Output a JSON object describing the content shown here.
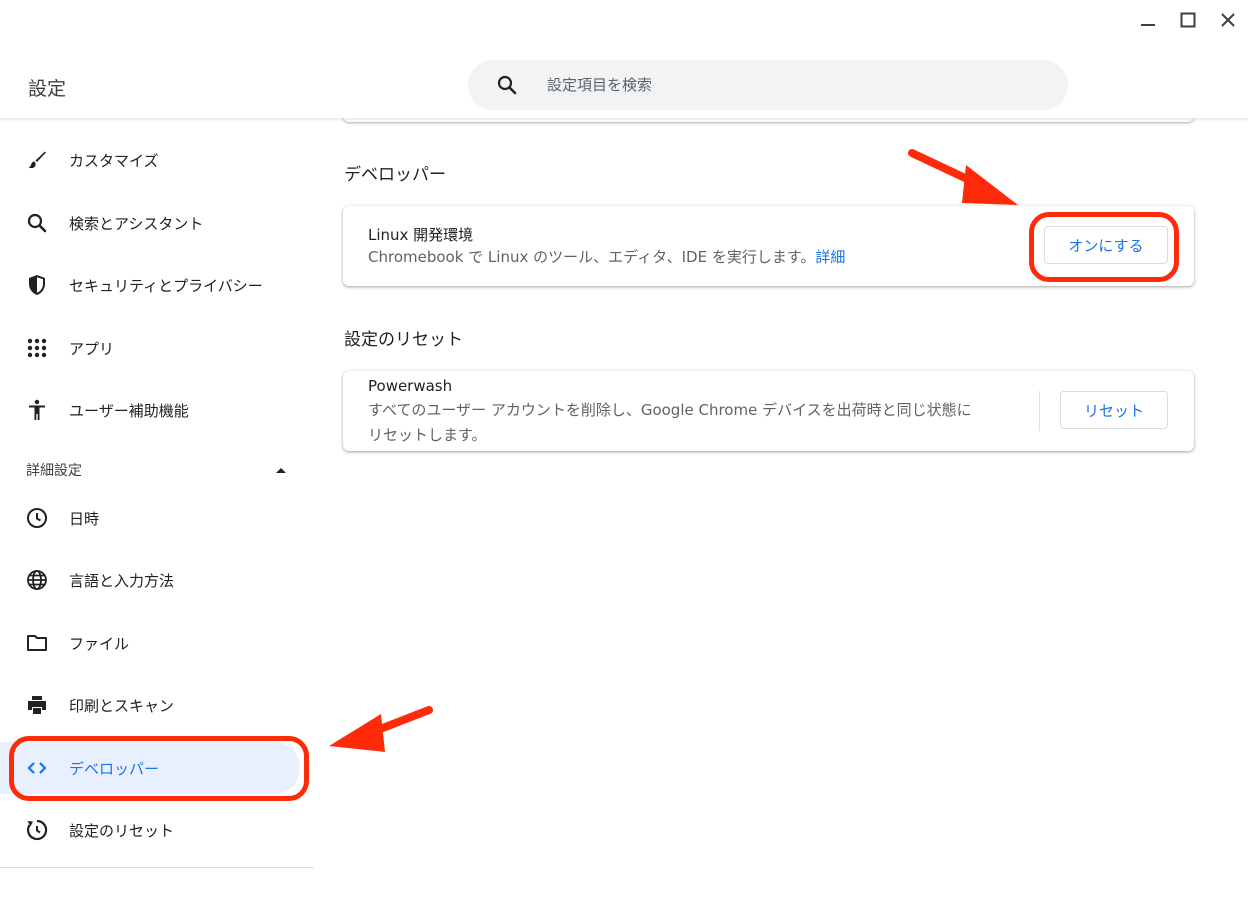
{
  "app": {
    "title": "設定"
  },
  "window_controls": {
    "minimize_icon": "minimize-icon",
    "maximize_icon": "maximize-icon",
    "close_icon": "close-icon"
  },
  "search": {
    "placeholder": "設定項目を検索",
    "icon": "search-icon"
  },
  "sidebar": {
    "items": [
      {
        "label": "カスタマイズ",
        "icon": "brush-icon"
      },
      {
        "label": "検索とアシスタント",
        "icon": "search-icon"
      },
      {
        "label": "セキュリティとプライバシー",
        "icon": "shield-icon"
      },
      {
        "label": "アプリ",
        "icon": "apps-grid-icon"
      },
      {
        "label": "ユーザー補助機能",
        "icon": "accessibility-icon"
      }
    ],
    "advanced": {
      "label": "詳細設定",
      "icon": "caret-up-icon"
    },
    "advanced_items": [
      {
        "label": "日時",
        "icon": "clock-icon"
      },
      {
        "label": "言語と入力方法",
        "icon": "globe-icon"
      },
      {
        "label": "ファイル",
        "icon": "folder-icon"
      },
      {
        "label": "印刷とスキャン",
        "icon": "printer-icon"
      },
      {
        "label": "デベロッパー",
        "icon": "code-icon",
        "active": true
      },
      {
        "label": "設定のリセット",
        "icon": "reset-icon"
      }
    ]
  },
  "main": {
    "developer": {
      "title": "デベロッパー",
      "linux": {
        "title": "Linux 開発環境",
        "description": "Chromebook で Linux のツール、エディタ、IDE を実行します。",
        "link": "詳細",
        "button": "オンにする"
      }
    },
    "reset": {
      "title": "設定のリセット",
      "powerwash": {
        "title": "Powerwash",
        "description_line1": "すべてのユーザー アカウントを削除し、Google Chrome デバイスを出荷時と同じ状態に",
        "description_line2": "リセットします。",
        "button": "リセット"
      }
    }
  },
  "annotations": {
    "highlight_color": "#ff2a0a"
  },
  "colors": {
    "accent": "#1a73e8",
    "active_bg": "#e8f0fe"
  }
}
